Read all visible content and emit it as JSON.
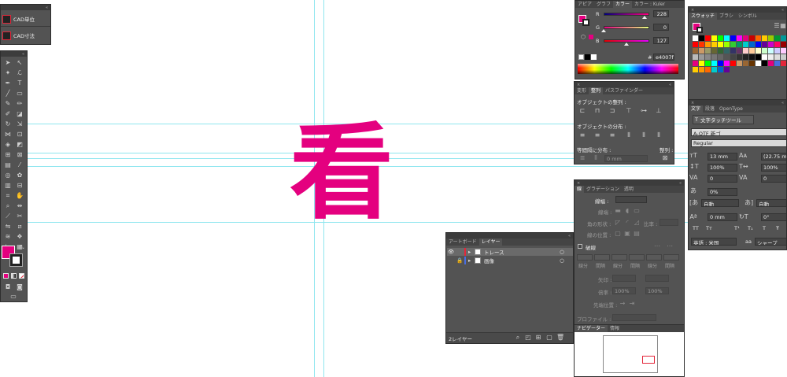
{
  "canvas": {
    "glyph": "看",
    "glyph_color": "#e4007f",
    "guide_color": "#8fe6ef"
  },
  "cad_panel": {
    "items": [
      {
        "icon": "cad-unit-icon",
        "label": "CAD単位"
      },
      {
        "icon": "cad-dimension-icon",
        "label": "CAD寸法"
      }
    ]
  },
  "color_panel": {
    "tabs": [
      "アピア",
      "グラフ",
      "カラー",
      "カラー : Kuler"
    ],
    "active_tab": "カラー",
    "channels": [
      {
        "label": "R",
        "value": "228",
        "level": 0.894
      },
      {
        "label": "G",
        "value": "0",
        "level": 0.0
      },
      {
        "label": "B",
        "value": "127",
        "level": 0.498
      }
    ],
    "hash": "#",
    "hex": "e4007f",
    "fill_color": "#e4007f"
  },
  "swatch_panel": {
    "tabs": [
      "スウォッチ",
      "ブラシ",
      "シンボル"
    ],
    "active_tab": "スウォッチ"
  },
  "align_panel": {
    "tabs": [
      "変形",
      "整列",
      "パスファインダー"
    ],
    "active_tab": "整列",
    "align_objects_label": "オブジェクトの整列 :",
    "distribute_objects_label": "オブジェクトの分布 :",
    "distribute_spacing_label": "等間隔に分布 :",
    "align_to_label": "整列 :",
    "spacing_value": "0 mm"
  },
  "char_panel": {
    "tabs": [
      "文字",
      "段落",
      "OpenType"
    ],
    "active_tab": "文字",
    "touch_tool_label": "文字タッチツール",
    "font_family": "A-OTF 新ゴ",
    "font_style": "Regular",
    "font_size": "13 mm",
    "leading": "(22.75 m",
    "vertical_scale": "100%",
    "horizontal_scale": "100%",
    "kerning": "0",
    "tracking": "0",
    "tsume": "0%",
    "aki_left": "自動",
    "aki_right": "自動",
    "baseline_shift": "0 mm",
    "rotation": "0°",
    "language": "英語 : 米国",
    "antialias_prefix": "aa",
    "antialias": "シャープ",
    "style_buttons": [
      "TT",
      "Tт",
      "T¹",
      "T₁",
      "T",
      "Ŧ"
    ]
  },
  "stroke_panel": {
    "tabs": [
      "線",
      "グラデーション",
      "透明"
    ],
    "active_tab": "線",
    "weight_label": "線幅 :",
    "cap_label": "線端 :",
    "corner_label": "角の形状 :",
    "limit_label": "比率 :",
    "align_label": "線の位置 :",
    "dashed_label": "破線",
    "dash_labels": [
      "線分",
      "間隔",
      "線分",
      "間隔",
      "線分",
      "間隔"
    ],
    "arrow_label": "矢印 :",
    "scale_label": "倍率 :",
    "scale_values": [
      "100%",
      "100%"
    ],
    "arrow_pos_label": "先端位置 :",
    "profile_label": "プロファイル :"
  },
  "layers_panel": {
    "tabs": [
      "アートボード",
      "レイヤー"
    ],
    "active_tab": "レイヤー",
    "layers": [
      {
        "name": "トレース",
        "color": "#e3263a",
        "visible": true,
        "locked": false,
        "selected": true
      },
      {
        "name": "画像",
        "color": "#4a6ee0",
        "visible": false,
        "locked": true,
        "selected": false
      }
    ],
    "count_label": "2レイヤー"
  },
  "navigator_panel": {
    "tabs": [
      "ナビゲーター",
      "情報"
    ],
    "active_tab": "ナビゲーター",
    "view_box_color": "#e3263a"
  },
  "toolbox": {
    "fill_color": "#e4007f"
  }
}
